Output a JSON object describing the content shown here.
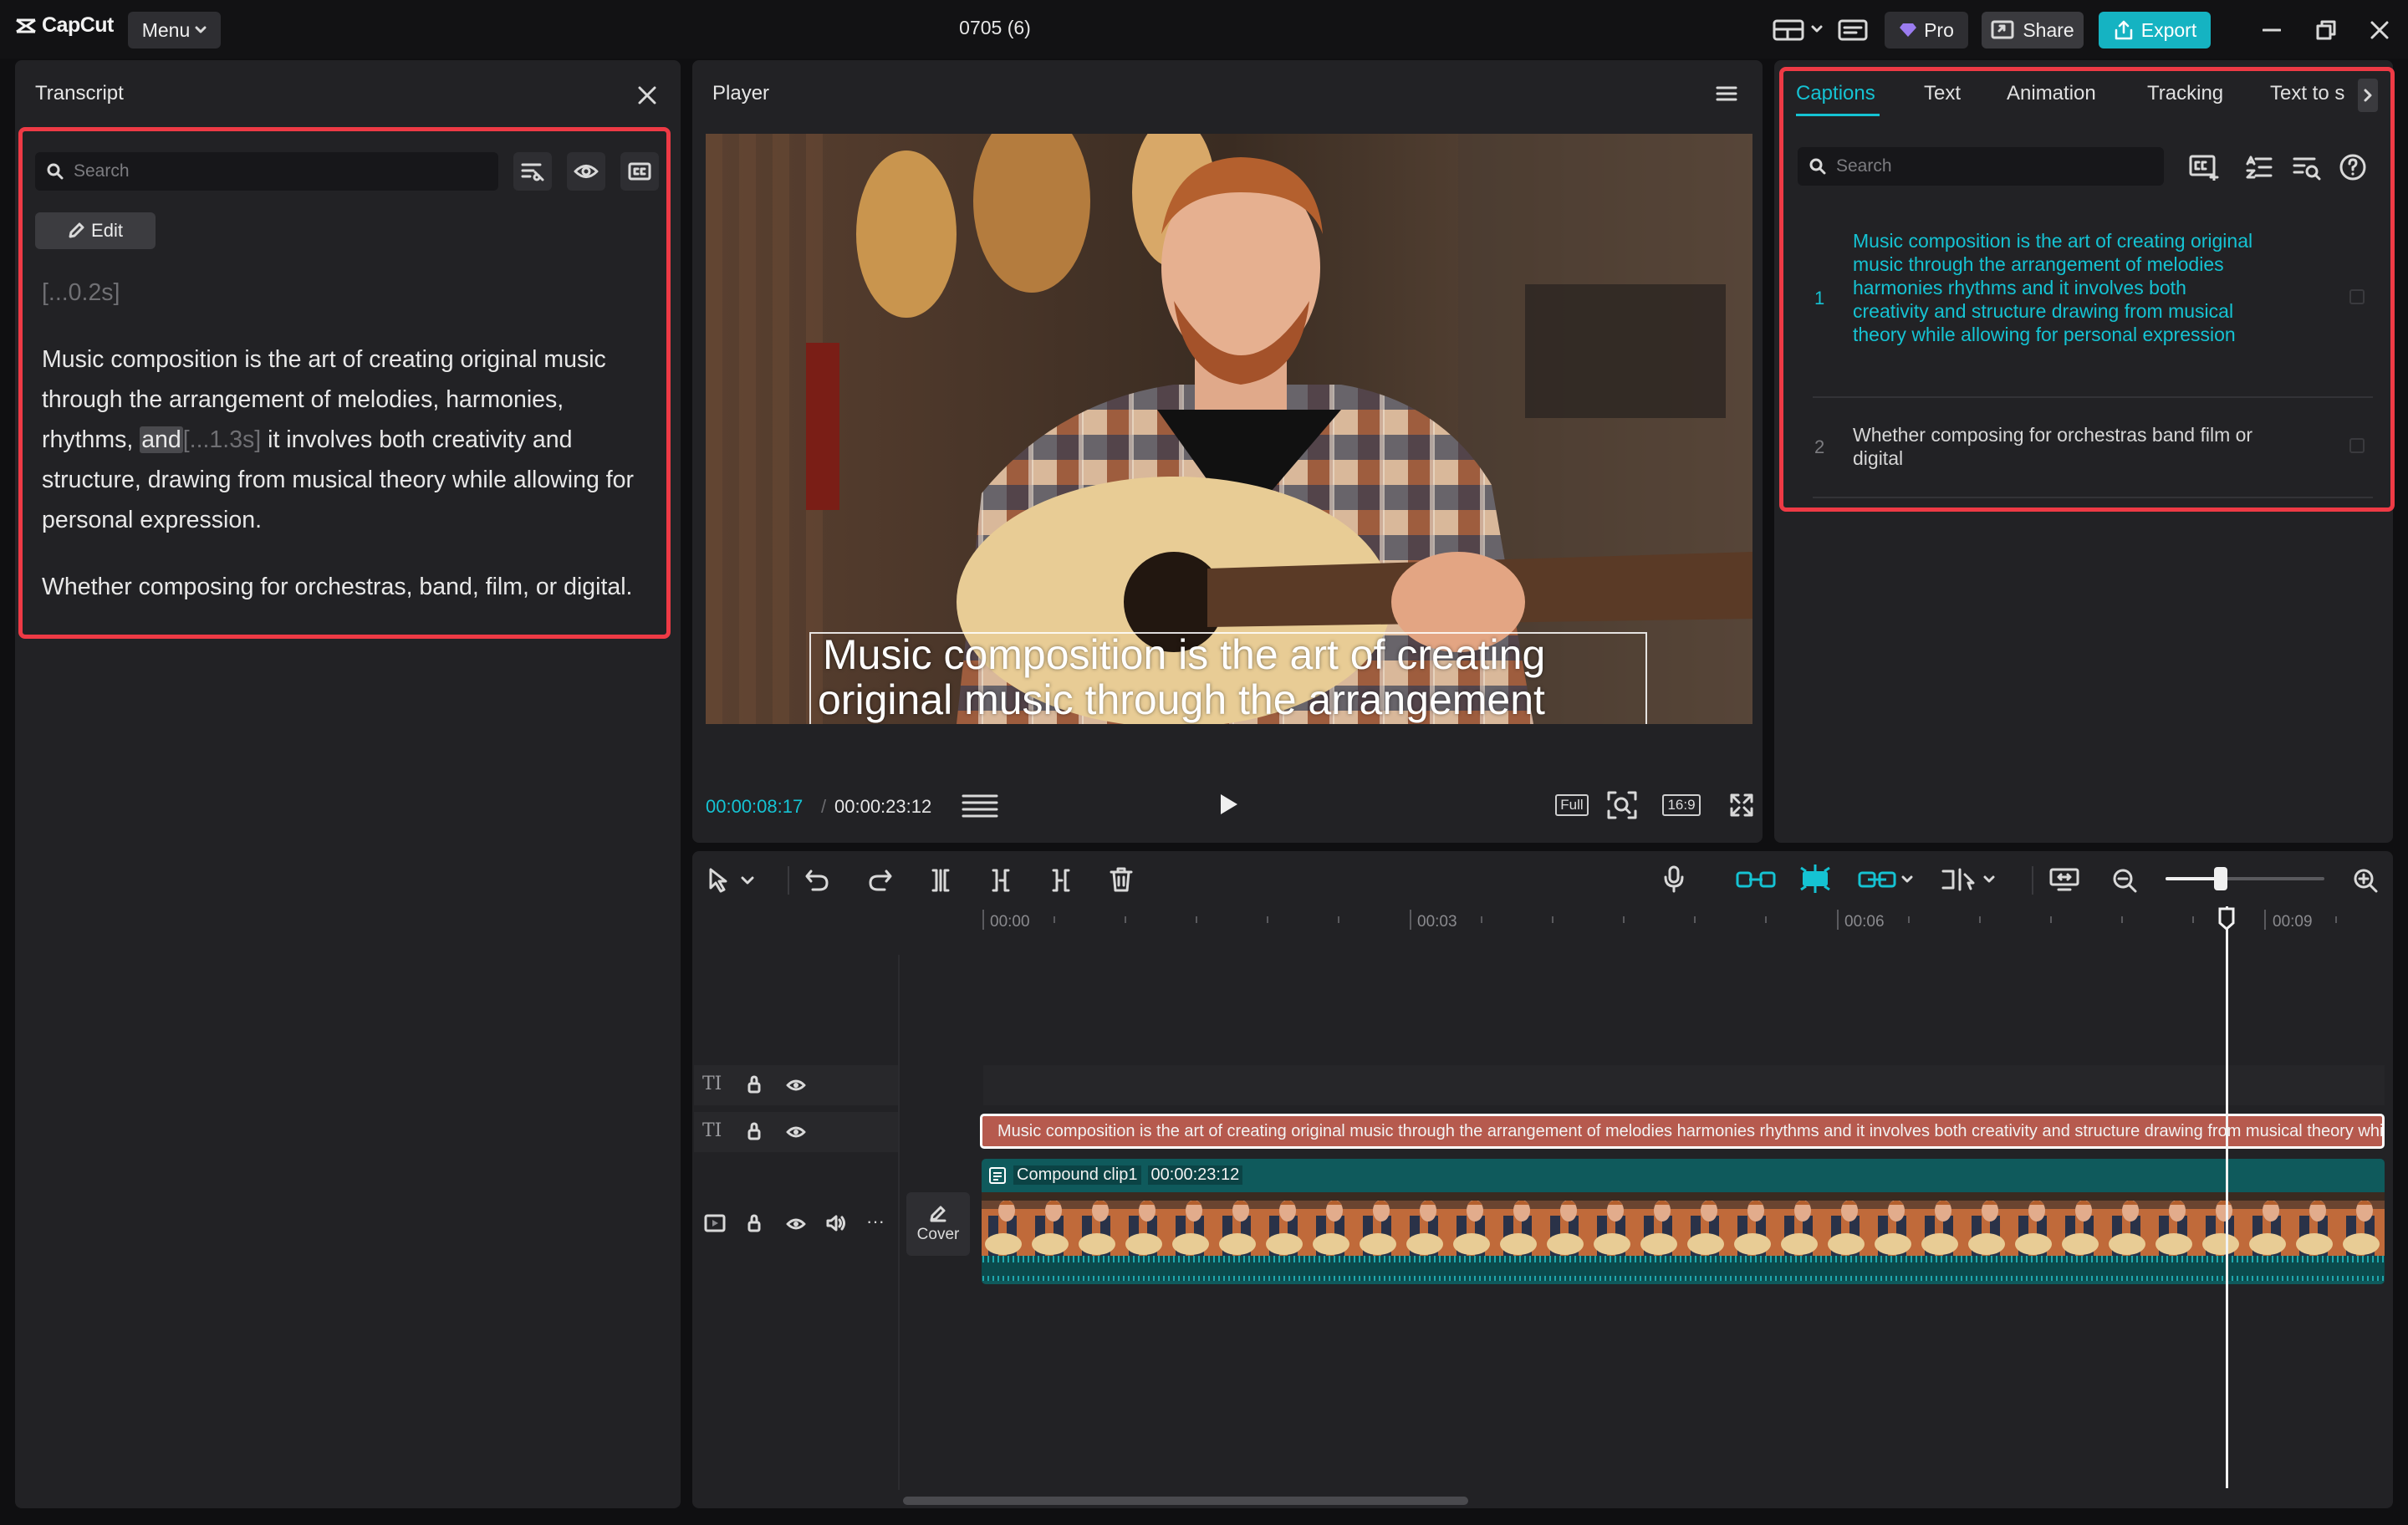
{
  "app": {
    "logo_text": "CapCut",
    "menu_label": "Menu",
    "project_title": "0705 (6)",
    "pro_label": "Pro",
    "share_label": "Share",
    "export_label": "Export",
    "accent": "#15b3c2",
    "highlight_red": "#ee3a45"
  },
  "transcript": {
    "title": "Transcript",
    "search_placeholder": "Search",
    "edit_label": "Edit",
    "pause_top": "[...0.2s]",
    "para1": {
      "before": "Music composition is the art of creating original music through the arrangement of melodies, harmonies, rhythms, ",
      "highlight": "and",
      "pause": "[...1.3s]",
      "after": " it involves both creativity and structure, drawing from musical theory while allowing for personal expression."
    },
    "para2": "Whether composing for orchestras, band, film, or digital."
  },
  "player": {
    "title": "Player",
    "overlay_line1": "Music composition is the art of creating",
    "overlay_line2": "original music through the arrangement",
    "current_time": "00:00:08:17",
    "separator": "/",
    "total_time": "00:00:23:12",
    "full_label": "Full",
    "ratio_label": "16:9"
  },
  "captions_panel": {
    "tabs": [
      "Captions",
      "Text",
      "Animation",
      "Tracking",
      "Text to s"
    ],
    "active_tab": "Captions",
    "search_placeholder": "Search",
    "items": [
      {
        "num": "1",
        "text": "Music composition is the art of creating original music through the arrangement of melodies harmonies rhythms and it involves both creativity and structure drawing from musical theory while allowing for personal expression",
        "active": true
      },
      {
        "num": "2",
        "text": "Whether composing for orchestras band film or digital",
        "active": false
      }
    ]
  },
  "timeline": {
    "ruler": [
      "00:00",
      "00:03",
      "00:06",
      "00:09"
    ],
    "cover_label": "Cover",
    "caption_clip_text": "Music composition is the art of creating original music through the arrangement of melodies harmonies rhythms and it involves both creativity and structure drawing from musical theory while allowing for personal expression",
    "compound_clip_name": "Compound clip1",
    "compound_clip_duration": "00:00:23:12",
    "more_label": "···",
    "text_track_label": "TI"
  }
}
